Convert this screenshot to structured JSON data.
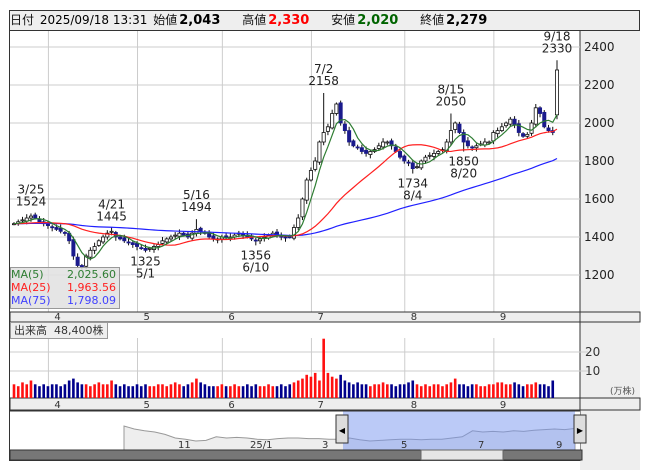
{
  "header": {
    "date_label": "日付",
    "datetime": "2025/09/18 13:31",
    "open_label": "始値",
    "open": "2,043",
    "high_label": "高値",
    "high": "2,330",
    "low_label": "安値",
    "low": "2,020",
    "close_label": "終値",
    "close": "2,279"
  },
  "legend": {
    "ma5_label": "MA(5)",
    "ma5_value": "2,025.60",
    "ma25_label": "MA(25)",
    "ma25_value": "1,963.56",
    "ma75_label": "MA(75)",
    "ma75_value": "1,798.09"
  },
  "volume": {
    "label": "出来高",
    "value": "48,400株",
    "unit": "(万株)"
  },
  "colors": {
    "up": "#ffffff",
    "down": "#1a1a8c",
    "ma5": "#2e7d32",
    "ma25": "#ff2020",
    "ma75": "#2020ff",
    "vol_up": "#ff1010",
    "vol_down": "#00008b",
    "high": "#ff0000",
    "low": "#006400"
  },
  "chart_data": {
    "type": "candlestick",
    "ylim": [
      1005,
      2489
    ],
    "yticks": [
      2400,
      2200,
      2000,
      1800,
      1600,
      1400,
      1200
    ],
    "month_labels": [
      "4",
      "5",
      "6",
      "7",
      "8",
      "9"
    ],
    "month_start_index": [
      10,
      31,
      51,
      72,
      94,
      115
    ],
    "closes": [
      1470,
      1480,
      1490,
      1500,
      1510,
      1500,
      1480,
      1470,
      1460,
      1450,
      1440,
      1430,
      1420,
      1380,
      1300,
      1250,
      1240,
      1300,
      1330,
      1350,
      1380,
      1400,
      1420,
      1430,
      1400,
      1390,
      1380,
      1370,
      1360,
      1350,
      1340,
      1330,
      1340,
      1350,
      1360,
      1380,
      1390,
      1400,
      1410,
      1420,
      1410,
      1400,
      1420,
      1440,
      1430,
      1420,
      1400,
      1390,
      1390,
      1400,
      1395,
      1400,
      1410,
      1420,
      1410,
      1400,
      1390,
      1380,
      1390,
      1400,
      1410,
      1420,
      1410,
      1400,
      1395,
      1400,
      1450,
      1500,
      1600,
      1700,
      1750,
      1800,
      1900,
      1950,
      1980,
      2050,
      2100,
      2000,
      1960,
      1900,
      1880,
      1870,
      1850,
      1840,
      1850,
      1860,
      1880,
      1900,
      1900,
      1880,
      1850,
      1820,
      1800,
      1790,
      1760,
      1770,
      1800,
      1820,
      1830,
      1840,
      1850,
      1860,
      1900,
      1960,
      2000,
      1950,
      1900,
      1880,
      1870,
      1880,
      1890,
      1900,
      1900,
      1950,
      1960,
      1980,
      2000,
      2020,
      1990,
      1950,
      1930,
      1940,
      2000,
      2080,
      2050,
      1980,
      1960,
      1950,
      2279
    ],
    "last_ohlc": [
      2043,
      2330,
      2020,
      2279
    ],
    "volume_man": [
      3,
      2,
      4,
      3,
      5,
      3,
      2,
      3,
      2,
      3,
      3,
      2,
      3,
      5,
      6,
      4,
      3,
      3,
      2,
      3,
      4,
      3,
      3,
      5,
      3,
      2,
      3,
      2,
      2,
      3,
      2,
      3,
      2,
      2,
      3,
      3,
      2,
      3,
      4,
      3,
      2,
      3,
      4,
      6,
      4,
      3,
      2,
      2,
      2,
      3,
      2,
      2,
      3,
      2,
      2,
      3,
      2,
      3,
      2,
      2,
      3,
      2,
      2,
      3,
      2,
      3,
      4,
      5,
      6,
      8,
      7,
      9,
      5,
      27,
      9,
      7,
      6,
      8,
      5,
      4,
      3,
      4,
      3,
      3,
      2,
      3,
      3,
      4,
      3,
      3,
      2,
      3,
      3,
      4,
      5,
      3,
      2,
      3,
      2,
      3,
      3,
      2,
      3,
      4,
      6,
      3,
      3,
      2,
      3,
      3,
      2,
      2,
      3,
      3,
      4,
      4,
      3,
      3,
      4,
      3,
      2,
      3,
      3,
      4,
      3,
      3,
      2,
      5
    ],
    "volume_ticks": [
      "20",
      "10"
    ],
    "annotations": [
      {
        "date": "3/25",
        "price": "1524",
        "idx": 4,
        "p": 1524,
        "pos": "above"
      },
      {
        "date": "4/21",
        "price": "1445",
        "idx": 23,
        "p": 1445,
        "pos": "above"
      },
      {
        "date": "5/1",
        "price": "1325",
        "idx": 31,
        "p": 1325,
        "pos": "below"
      },
      {
        "date": "5/16",
        "price": "1494",
        "idx": 43,
        "p": 1494,
        "pos": "above"
      },
      {
        "date": "6/10",
        "price": "1356",
        "idx": 57,
        "p": 1356,
        "pos": "below"
      },
      {
        "date": "7/2",
        "price": "2158",
        "idx": 73,
        "p": 2158,
        "pos": "above"
      },
      {
        "date": "8/4",
        "price": "1734",
        "idx": 94,
        "p": 1734,
        "pos": "below"
      },
      {
        "date": "8/15",
        "price": "2050",
        "idx": 103,
        "p": 2050,
        "pos": "above"
      },
      {
        "date": "8/20",
        "price": "1850",
        "idx": 106,
        "p": 1850,
        "pos": "below"
      },
      {
        "date": "9/18",
        "price": "2330",
        "idx": 128,
        "p": 2330,
        "pos": "above"
      }
    ]
  },
  "navigator": {
    "labels": [
      "11",
      "25/1",
      "3",
      "5",
      "7",
      "9"
    ],
    "values": [
      80,
      75,
      72,
      70,
      66,
      60,
      58,
      55,
      56,
      62,
      60,
      61,
      60,
      58,
      57,
      59,
      60,
      60,
      59,
      59,
      58,
      58,
      60,
      57,
      55,
      56,
      57,
      58,
      58,
      57,
      58,
      58,
      60,
      62,
      72,
      70,
      71,
      70,
      72,
      71,
      73,
      74,
      75,
      74,
      76
    ]
  }
}
